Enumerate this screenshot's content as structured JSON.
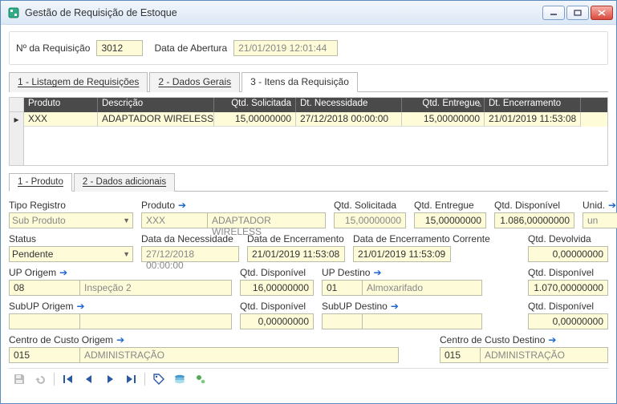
{
  "window": {
    "title": "Gestão de Requisição de Estoque"
  },
  "header": {
    "req_no_label": "Nº da Requisição",
    "req_no_value": "3012",
    "open_date_label": "Data de Abertura",
    "open_date_value": "21/01/2019 12:01:44"
  },
  "tabs": {
    "t1": "1 - Listagem de Requisições",
    "t2": "2 - Dados Gerais",
    "t3": "3 - Itens da Requisição"
  },
  "grid": {
    "cols": {
      "c1": "Produto",
      "c2": "Descrição",
      "c3": "Qtd. Solicitada",
      "c4": "Dt. Necessidade",
      "c5": "Qtd. Entregue",
      "c6": "Dt. Encerramento"
    },
    "rows": [
      {
        "c1": "XXX",
        "c2": "ADAPTADOR WIRELESS",
        "c3": "15,00000000",
        "c4": "27/12/2018 00:00:00",
        "c5": "15,00000000",
        "c6": "21/01/2019 11:53:08"
      }
    ]
  },
  "subtabs": {
    "t1": "1 - Produto",
    "t2": "2 - Dados adicionais"
  },
  "form": {
    "tipo_registro_label": "Tipo Registro",
    "tipo_registro_value": "Sub Produto",
    "produto_label": "Produto",
    "produto_code": "XXX",
    "produto_desc": "ADAPTADOR WIRELESS",
    "qtd_solic_label": "Qtd. Solicitada",
    "qtd_solic_value": "15,00000000",
    "qtd_entregue_label": "Qtd. Entregue",
    "qtd_entregue_value": "15,00000000",
    "qtd_disp_label": "Qtd. Disponível",
    "qtd_disp_value": "1.086,00000000",
    "unid_label": "Unid.",
    "unid_value": "un",
    "status_label": "Status",
    "status_value": "Pendente",
    "data_necess_label": "Data da Necessidade",
    "data_necess_value": "27/12/2018 00:00:00",
    "data_encerr_label": "Data de Encerramento",
    "data_encerr_value": "21/01/2019 11:53:08",
    "data_encerr_corr_label": "Data de Encerramento Corrente",
    "data_encerr_corr_value": "21/01/2019 11:53:09",
    "qtd_devolv_label": "Qtd. Devolvida",
    "qtd_devolv_value": "0,00000000",
    "up_origem_label": "UP Origem",
    "up_origem_code": "08",
    "up_origem_desc": "Inspeção 2",
    "up_origem_disp_label": "Qtd. Disponível",
    "up_origem_disp_value": "16,00000000",
    "up_destino_label": "UP Destino",
    "up_destino_code": "01",
    "up_destino_desc": "Almoxarifado",
    "up_destino_disp_label": "Qtd. Disponível",
    "up_destino_disp_value": "1.070,00000000",
    "subup_origem_label": "SubUP Origem",
    "subup_origem_disp_label": "Qtd. Disponível",
    "subup_origem_disp_value": "0,00000000",
    "subup_destino_label": "SubUP Destino",
    "subup_destino_disp_label": "Qtd. Disponível",
    "subup_destino_disp_value": "0,00000000",
    "cc_origem_label": "Centro de Custo Origem",
    "cc_origem_code": "015",
    "cc_origem_desc": "ADMINISTRAÇÃO",
    "cc_destino_label": "Centro de Custo Destino",
    "cc_destino_code": "015",
    "cc_destino_desc": "ADMINISTRAÇÃO"
  }
}
